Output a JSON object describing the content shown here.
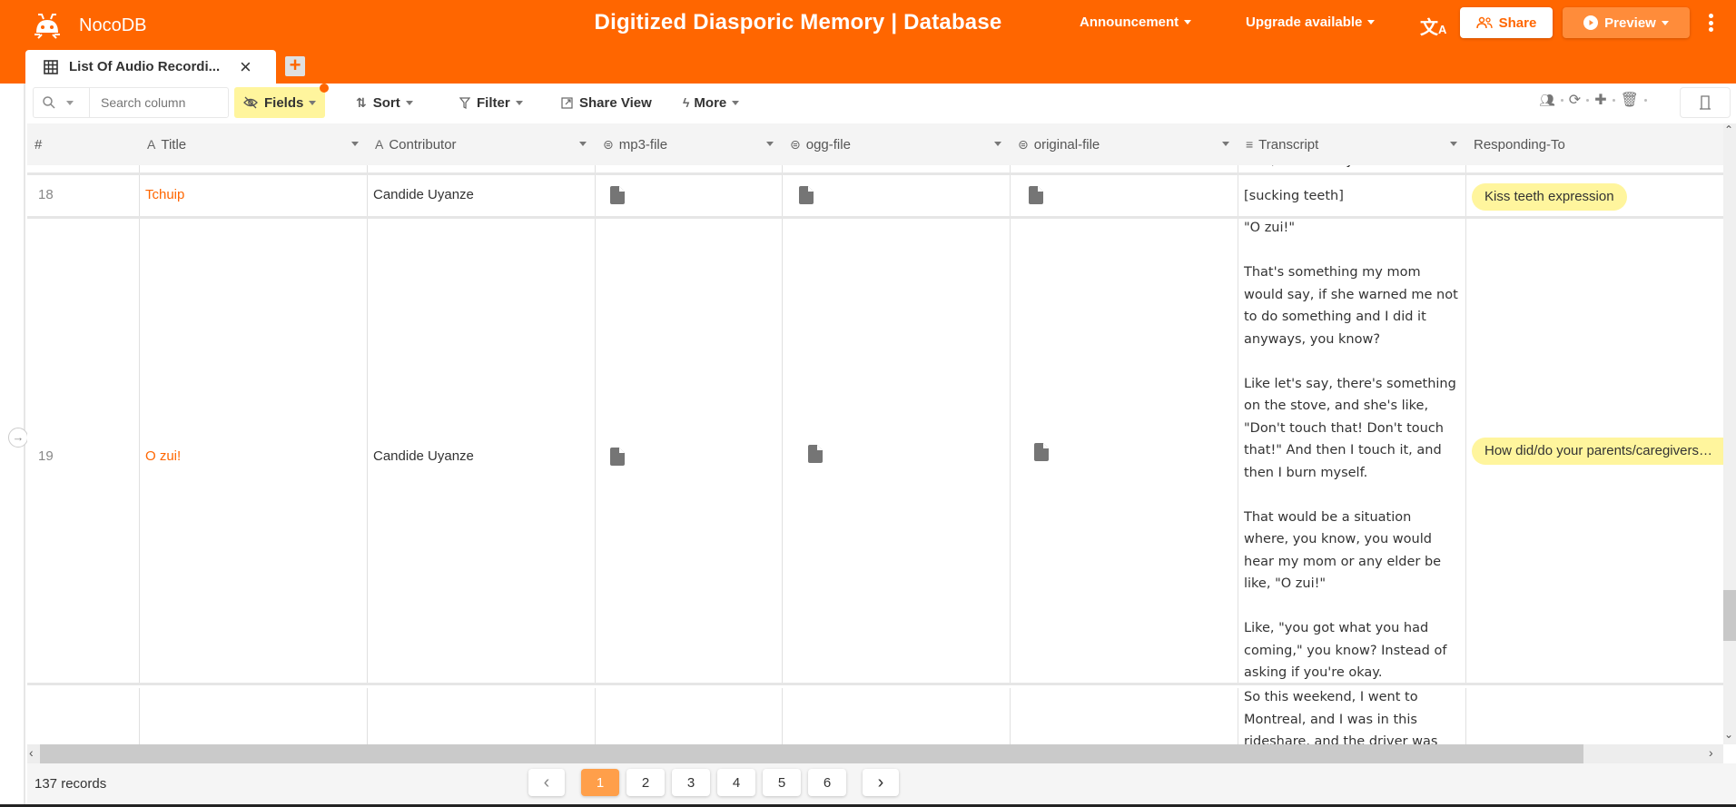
{
  "app": {
    "name": "NocoDB",
    "title": "Digitized Diasporic Memory | Database",
    "brand_color": "#ff6600",
    "menus": {
      "announcement": "Announcement",
      "upgrade": "Upgrade available",
      "translate_icon": "translate-icon",
      "share": "Share",
      "preview": "Preview"
    }
  },
  "tabs": [
    {
      "label": "List Of Audio Recordi...",
      "icon": "grid-icon",
      "active": true
    }
  ],
  "toolbar": {
    "search_placeholder": "Search column",
    "fields": "Fields",
    "sort": "Sort",
    "filter": "Filter",
    "share_view": "Share View",
    "more": "More"
  },
  "columns": [
    {
      "label": "#",
      "type": ""
    },
    {
      "label": "Title",
      "type": "text"
    },
    {
      "label": "Contributor",
      "type": "text"
    },
    {
      "label": "mp3-file",
      "type": "attachment"
    },
    {
      "label": "ogg-file",
      "type": "attachment"
    },
    {
      "label": "original-file",
      "type": "attachment"
    },
    {
      "label": "Transcript",
      "type": "long-text"
    },
    {
      "label": "Responding-To",
      "type": "link"
    }
  ],
  "rows": [
    {
      "num": "",
      "transcript_tail": "coin, I would say."
    },
    {
      "num": "18",
      "title": "Tchuip",
      "contributor": "Candide Uyanze",
      "transcript": "[sucking teeth]",
      "responding_to": "Kiss teeth expression"
    },
    {
      "num": "19",
      "title": "O zui!",
      "contributor": "Candide Uyanze",
      "transcript": "\"O zui!\"\n\nThat's something my mom would say, if she warned me not to do something and I did it anyways, you know?\n\nLike let's say, there's something on the stove, and she's like, \"Don't touch that! Don't touch that!\" And then I touch it, and then I burn myself.\n\nThat would be a situation where, you know, you would hear my mom or any elder be like, \"O zui!\"\n\nLike, \"you got what you had coming,\" you know? Instead of asking if you're okay.",
      "responding_to": "How did/do your parents/caregivers/a..."
    },
    {
      "num": "",
      "transcript": "So this weekend, I went to Montreal, and I was in this rideshare, and the driver was"
    }
  ],
  "footer": {
    "records": "137 records",
    "pages": [
      "1",
      "2",
      "3",
      "4",
      "5",
      "6"
    ],
    "current_page": "1"
  }
}
